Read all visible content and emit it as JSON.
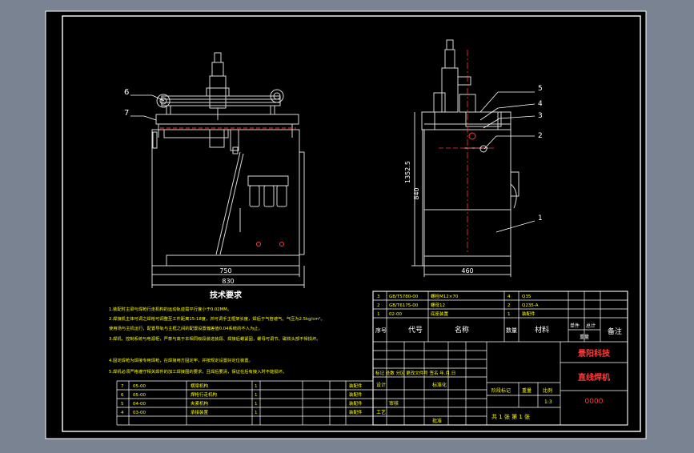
{
  "palette": {
    "window_bg": "#7a8392",
    "paper": "#000000",
    "line": "#ffffff",
    "gray": "#d8d8d8",
    "text_yellow": "#ffff00",
    "text_red": "#ff3b3b",
    "annotation": "#00ff66",
    "frame_purple": "#b080ff"
  },
  "tech_notes": {
    "title": "技术要求",
    "items": [
      "1.装配时主梁与焊枪行走机构的运动轨迹需平行度小于0.02MM。",
      "2.焊接机主体可调之焊枪可调整至工件距离15-18度，并可调手主框架长度，焊后于气管遮气。气压为2.5kg/cm²。",
      "   使用场与主机运行，配置导轨与主框之间的配置设置偏差值0.04系统的不入为止。",
      "3.焊机、控制系统与电源柜，严禁与高于本相同级段装进装段、焊接后螺紧固，螺母可调节、磁铁头部不得损坏。",
      "4.固定焊枪为焊接专用焊枪，在焊接用方固定牢，并按规定设置好定位装置。",
      "5.焊机必须严格遵守相关焊件的加工焊接图的要求，且焊后要清，保证在后有接入时不能损坏。"
    ]
  },
  "dimensions": {
    "front_inner_width": "750",
    "front_outer_width": "830",
    "side_width": "460",
    "side_height_total": "1352.5",
    "side_height_inner": "840"
  },
  "callouts": {
    "front": [
      "6",
      "7"
    ],
    "side": [
      "5",
      "4",
      "3",
      "2",
      "1"
    ]
  },
  "bom_lower": [
    {
      "no": "7",
      "code": "05-00",
      "name": "横梁机构",
      "qty": "1",
      "note": "装配件"
    },
    {
      "no": "6",
      "code": "05-00",
      "name": "焊枪行走机构",
      "qty": "1",
      "note": "装配件"
    },
    {
      "no": "5",
      "code": "04-00",
      "name": "夹紧机构",
      "qty": "1",
      "note": "装配件"
    },
    {
      "no": "4",
      "code": "03-00",
      "name": "承接装置",
      "qty": "1",
      "note": "装配件"
    }
  ],
  "bom_upper": [
    {
      "no": "3",
      "code": "GB/T5780-00",
      "name": "螺栓M12×70",
      "qty": "4",
      "material": "Q35"
    },
    {
      "no": "2",
      "code": "GB/T6175-00",
      "name": "螺母12",
      "qty": "2",
      "material": "Q235-A"
    },
    {
      "no": "1",
      "code": "02-00",
      "name": "底座装置",
      "qty": "1",
      "material": "装配件"
    }
  ],
  "header": {
    "seq": "序号",
    "code": "代号",
    "name": "名称",
    "qty": "数量",
    "material": "材料",
    "single": "单件",
    "total": "总计",
    "weight": "重量",
    "remark": "备注"
  },
  "title_block": {
    "org": "景阳科技",
    "drawing_name": "直线焊机",
    "drawing_no": "0000",
    "scale": "1:3",
    "stage_label": "阶段标记",
    "weight_label": "重量",
    "scale_label": "比例",
    "sheet_text": "共 1 张   第 1 张",
    "sign_row": "标记 处数 分区 更改文件号 签名 年.月.日",
    "design": "设计",
    "standard": "标准化",
    "audit": "审核",
    "process": "工艺",
    "approve": "批准"
  }
}
